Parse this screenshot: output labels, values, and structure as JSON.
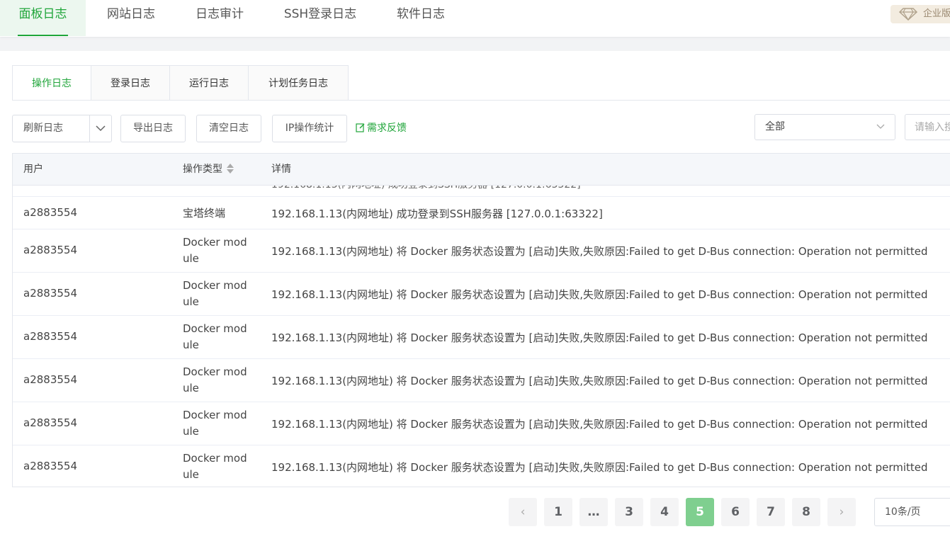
{
  "topnav": {
    "tabs": [
      {
        "label": "面板日志",
        "active": true
      },
      {
        "label": "网站日志",
        "active": false
      },
      {
        "label": "日志审计",
        "active": false
      },
      {
        "label": "SSH登录日志",
        "active": false
      },
      {
        "label": "软件日志",
        "active": false
      }
    ],
    "enterprise_badge": "企业版",
    "enterprise_icon": "diamond-icon"
  },
  "subtabs": [
    {
      "label": "操作日志",
      "active": true
    },
    {
      "label": "登录日志",
      "active": false
    },
    {
      "label": "运行日志",
      "active": false
    },
    {
      "label": "计划任务日志",
      "active": false
    }
  ],
  "toolbar": {
    "refresh_label": "刷新日志",
    "export_label": "导出日志",
    "clear_label": "清空日志",
    "ip_stats_label": "IP操作统计",
    "feedback_label": "需求反馈",
    "filter_selected": "全部",
    "search_placeholder": "请输入搜索关键字"
  },
  "table": {
    "columns": {
      "user": "用户",
      "type": "操作类型",
      "detail": "详情"
    },
    "rows": [
      {
        "user": "a2883554",
        "type": "宝塔终端",
        "detail": "192.168.1.13(内网地址) 成功登录到SSH服务器 [127.0.0.1:63322]"
      },
      {
        "user": "a2883554",
        "type": "Docker module",
        "detail": "192.168.1.13(内网地址) 将 Docker 服务状态设置为 [启动]失败,失败原因:Failed to get D-Bus connection: Operation not permitted"
      },
      {
        "user": "a2883554",
        "type": "Docker module",
        "detail": "192.168.1.13(内网地址) 将 Docker 服务状态设置为 [启动]失败,失败原因:Failed to get D-Bus connection: Operation not permitted"
      },
      {
        "user": "a2883554",
        "type": "Docker module",
        "detail": "192.168.1.13(内网地址) 将 Docker 服务状态设置为 [启动]失败,失败原因:Failed to get D-Bus connection: Operation not permitted"
      },
      {
        "user": "a2883554",
        "type": "Docker module",
        "detail": "192.168.1.13(内网地址) 将 Docker 服务状态设置为 [启动]失败,失败原因:Failed to get D-Bus connection: Operation not permitted"
      },
      {
        "user": "a2883554",
        "type": "Docker module",
        "detail": "192.168.1.13(内网地址) 将 Docker 服务状态设置为 [启动]失败,失败原因:Failed to get D-Bus connection: Operation not permitted"
      },
      {
        "user": "a2883554",
        "type": "Docker module",
        "detail": "192.168.1.13(内网地址) 将 Docker 服务状态设置为 [启动]失败,失败原因:Failed to get D-Bus connection: Operation not permitted"
      }
    ]
  },
  "pagination": {
    "prev": "‹",
    "pages": [
      "1",
      "…",
      "3",
      "4",
      "5",
      "6",
      "7",
      "8"
    ],
    "current": "5",
    "next": "›",
    "page_size": "10条/页"
  },
  "colors": {
    "accent": "#20a53a",
    "active_page": "#7fcf8f"
  }
}
